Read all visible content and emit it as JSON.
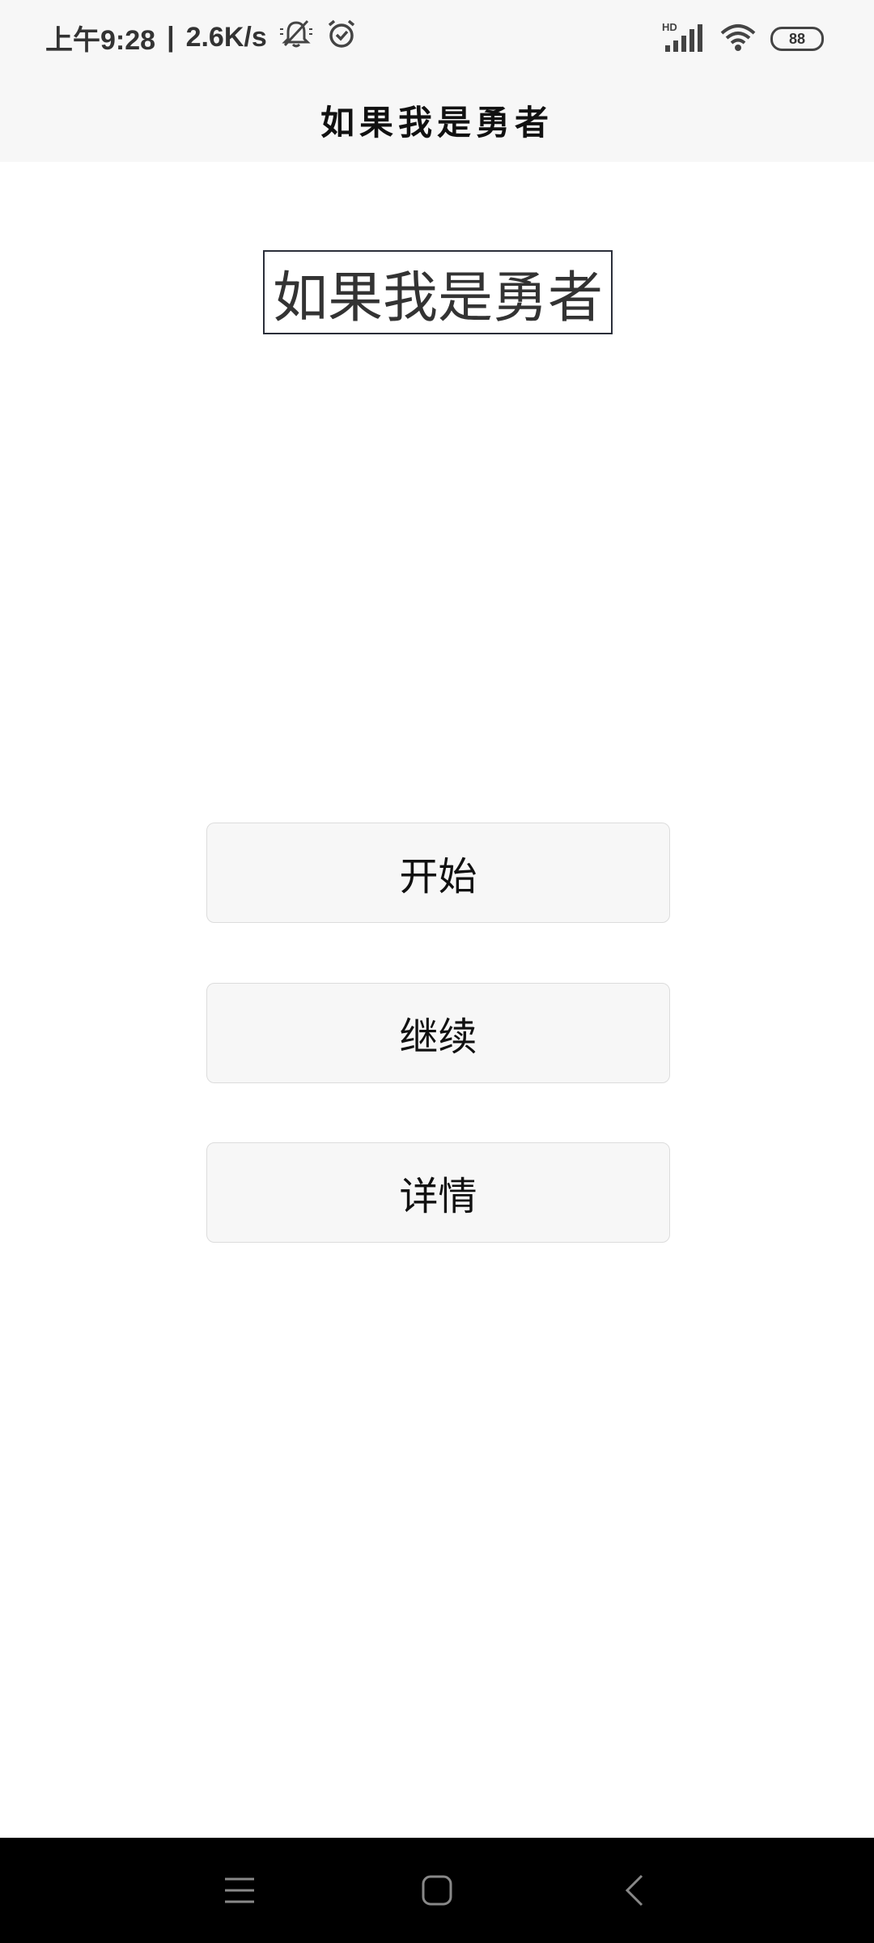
{
  "status_bar": {
    "time": "上午9:28",
    "separator": "|",
    "net_speed": "2.6K/s",
    "icons": [
      "mute-icon",
      "alarm-icon",
      "hd-icon",
      "signal-icon",
      "wifi-icon",
      "battery-icon"
    ],
    "hd_label": "HD",
    "battery_level": "88"
  },
  "app_bar": {
    "title": "如果我是勇者"
  },
  "main": {
    "hero_title": "如果我是勇者",
    "buttons": [
      {
        "label": "开始"
      },
      {
        "label": "继续"
      },
      {
        "label": "详情"
      }
    ]
  },
  "nav_bar": {
    "icons": [
      "menu-icon",
      "home-icon",
      "back-icon"
    ]
  },
  "colors": {
    "bar_background": "#f7f7f7",
    "button_background": "#f7f7f7",
    "text_primary": "#111111",
    "nav_background": "#000000"
  }
}
